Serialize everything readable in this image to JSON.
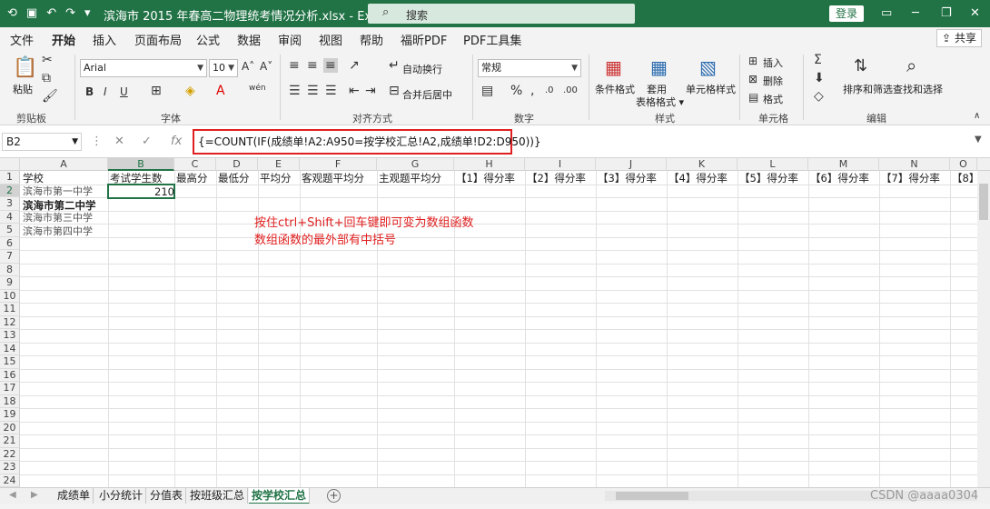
{
  "titlebar": {
    "title": "滨海市 2015 年春高二物理统考情况分析.xlsx  -  Excel",
    "search_placeholder": "搜索",
    "login_label": "登录",
    "quick_access": [
      "💾",
      "⚫",
      "↶",
      "↷",
      "▾"
    ]
  },
  "menu": {
    "tabs": [
      "文件",
      "开始",
      "插入",
      "页面布局",
      "公式",
      "数据",
      "审阅",
      "视图",
      "帮助",
      "福昕PDF",
      "PDF工具集"
    ],
    "active_tab": "开始",
    "share_label": "共享"
  },
  "ribbon": {
    "clipboard": {
      "paste": "粘贴",
      "label": "剪贴板"
    },
    "font": {
      "name": "Arial",
      "size": "10",
      "label": "字体",
      "bold": "B",
      "italic": "I",
      "underline": "U"
    },
    "alignment": {
      "wrap": "自动换行",
      "merge": "合并后居中",
      "label": "对齐方式"
    },
    "number": {
      "format": "常规",
      "label": "数字"
    },
    "styles": {
      "conditional": "条件格式",
      "table": "套用\n表格格式",
      "cell": "单元格样式",
      "label": "样式"
    },
    "cells": {
      "insert": "插入",
      "delete": "删除",
      "format": "格式",
      "label": "单元格"
    },
    "editing": {
      "sort": "排序和筛选",
      "find": "查找和选择",
      "label": "编辑"
    }
  },
  "formula_bar": {
    "name_box": "B2",
    "formula": "{=COUNT(IF(成绩单!A2:A950=按学校汇总!A2,成绩单!D2:D950))}"
  },
  "sheet": {
    "columns": [
      "A",
      "B",
      "C",
      "D",
      "E",
      "F",
      "G",
      "H",
      "I",
      "J",
      "K",
      "L",
      "M",
      "N",
      "O"
    ],
    "selected_column": "B",
    "selected_row": 2,
    "rows": [
      1,
      2,
      3,
      4,
      5,
      6,
      7,
      8,
      9,
      10,
      11,
      12,
      13,
      14,
      15,
      16,
      17,
      18,
      19,
      20,
      21,
      22,
      23,
      24
    ],
    "headers": [
      "学校",
      "考试学生数",
      "最高分",
      "最低分",
      "平均分",
      "客观题平均分",
      "主观题平均分",
      "【1】得分率",
      "【2】得分率",
      "【3】得分率",
      "【4】得分率",
      "【5】得分率",
      "【6】得分率",
      "【7】得分率",
      "【8】"
    ],
    "schools": [
      "滨海市第一中学",
      "滨海市第二中学",
      "滨海市第三中学",
      "滨海市第四中学"
    ],
    "b2_value": "210"
  },
  "annotation": {
    "line1": "按住ctrl+Shift+回车键即可变为数组函数",
    "line2": "数组函数的最外部有中括号"
  },
  "sheet_tabs": [
    "成绩单",
    "小分统计",
    "分值表",
    "按班级汇总",
    "按学校汇总"
  ],
  "active_sheet": "按学校汇总",
  "watermark": "CSDN @aaaa0304",
  "colors": {
    "accent": "#217346",
    "annotation": "#e02020"
  }
}
